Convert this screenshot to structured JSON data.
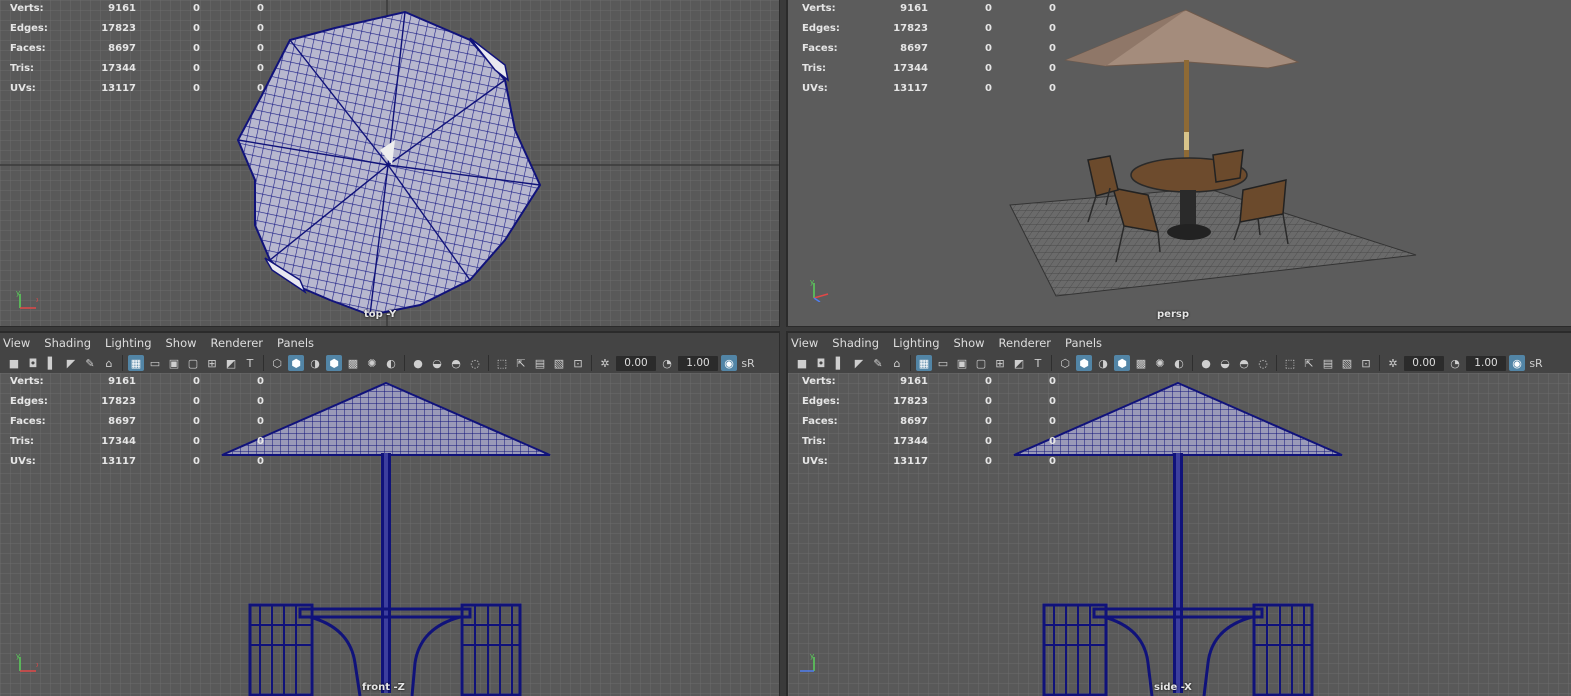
{
  "stats": [
    {
      "label": "Verts:",
      "a": "9161",
      "b": "0",
      "c": "0"
    },
    {
      "label": "Edges:",
      "a": "17823",
      "b": "0",
      "c": "0"
    },
    {
      "label": "Faces:",
      "a": "8697",
      "b": "0",
      "c": "0"
    },
    {
      "label": "Tris:",
      "a": "17344",
      "b": "0",
      "c": "0"
    },
    {
      "label": "UVs:",
      "a": "13117",
      "b": "0",
      "c": "0"
    }
  ],
  "viewports": {
    "top": {
      "camera": "top -Y"
    },
    "persp": {
      "camera": "persp"
    },
    "front": {
      "camera": "front -Z"
    },
    "side": {
      "camera": "side -X"
    }
  },
  "menu": [
    "View",
    "Shading",
    "Lighting",
    "Show",
    "Renderer",
    "Panels"
  ],
  "toolbar": {
    "exposure": "0.00",
    "gamma": "1.00",
    "color_space": "sR"
  },
  "colors": {
    "wire": "#10127a",
    "grid": "#6b6b6b",
    "bg": "#5a5a5a",
    "canopy": "#a58d7d",
    "wood": "#6b4a2c"
  }
}
